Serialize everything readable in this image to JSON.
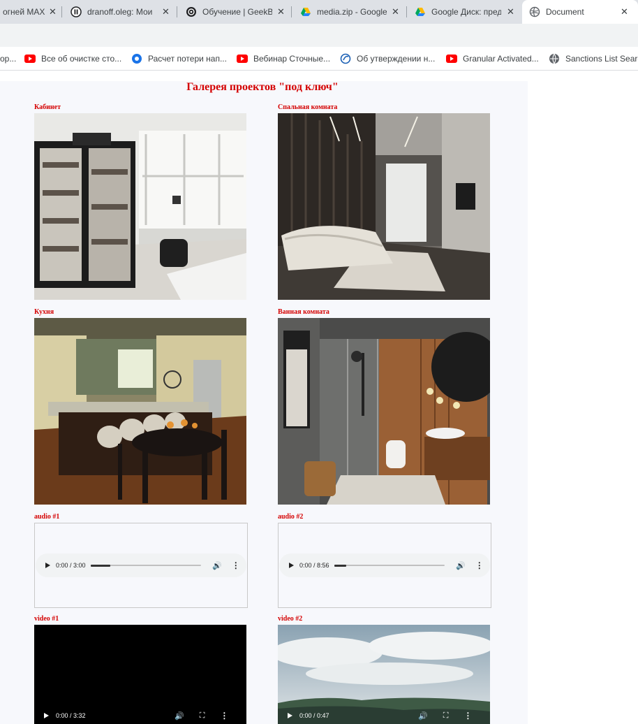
{
  "browser": {
    "tabs": [
      {
        "label": "огней МАХ",
        "active": false
      },
      {
        "label": "dranoff.oleg: Мои",
        "active": false
      },
      {
        "label": "Обучение | GeekBrains",
        "active": false
      },
      {
        "label": "media.zip - Google",
        "active": false
      },
      {
        "label": "Google Диск: пред",
        "active": false
      },
      {
        "label": "Document",
        "active": true
      }
    ],
    "close_glyph": "✕",
    "bookmarks": [
      {
        "label": "ор...",
        "icon": "generic-icon"
      },
      {
        "label": "Все об очистке сто...",
        "icon": "youtube-icon"
      },
      {
        "label": "Расчет потери нап...",
        "icon": "globe-blue-icon"
      },
      {
        "label": "Вебинар Сточные...",
        "icon": "youtube-icon"
      },
      {
        "label": "Об утверждении н...",
        "icon": "consultant-icon"
      },
      {
        "label": "Granular Activated...",
        "icon": "youtube-icon"
      },
      {
        "label": "Sanctions List Search",
        "icon": "globe-gray-icon"
      }
    ]
  },
  "page": {
    "title": "Галерея проектов \"под ключ\"",
    "photos": [
      {
        "caption": "Кабинет",
        "scene": "study-icon"
      },
      {
        "caption": "Спальная комната",
        "scene": "bedroom-icon"
      },
      {
        "caption": "Кухня",
        "scene": "kitchen-icon"
      },
      {
        "caption": "Ванная комната",
        "scene": "bathroom-icon"
      }
    ],
    "audios": [
      {
        "caption": "audio #1",
        "time": "0:00 / 3:00",
        "buffered": 0.18
      },
      {
        "caption": "audio #2",
        "time": "0:00 / 8:56",
        "buffered": 0.11
      }
    ],
    "videos": [
      {
        "caption": "video #1",
        "time": "0:00 / 3:32"
      },
      {
        "caption": "video #2",
        "time": "0:00 / 0:47"
      }
    ],
    "glyphs": {
      "volume": "🔊",
      "fullscreen": "⛶",
      "more": "⋮"
    }
  }
}
